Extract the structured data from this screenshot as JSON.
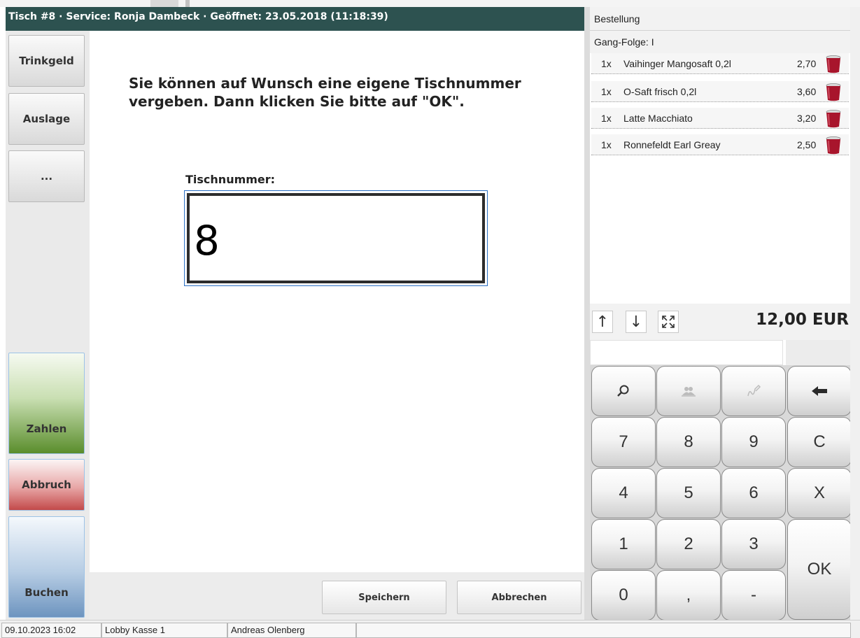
{
  "header": {
    "title": "Tisch #8 · Service: Ronja Dambeck · Geöffnet: 23.05.2018 (11:18:39)"
  },
  "sidebar": {
    "tip_label": "Trinkgeld",
    "display_label": "Auslage",
    "more_label": "...",
    "pay_label": "Zahlen",
    "abort_label": "Abbruch",
    "book_label": "Buchen"
  },
  "main": {
    "message": "Sie können auf Wunsch eine eigene Tischnummer vergeben. Dann klicken Sie bitte auf \"OK\".",
    "field_label": "Tischnummer:",
    "field_value": "8",
    "save_label": "Speichern",
    "cancel_label": "Abbrechen"
  },
  "order": {
    "title": "Bestellung",
    "course": "Gang-Folge: I",
    "items": [
      {
        "qty": "1x",
        "name": "Vaihinger Mangosaft 0,2l",
        "price": "2,70",
        "icon": "drink-cup-icon"
      },
      {
        "qty": "1x",
        "name": "O-Saft frisch 0,2l",
        "price": "3,60",
        "icon": "drink-cup-icon"
      },
      {
        "qty": "1x",
        "name": "Latte Macchiato",
        "price": "3,20",
        "icon": "drink-cup-icon"
      },
      {
        "qty": "1x",
        "name": "Ronnefeldt Earl Greay",
        "price": "2,50",
        "icon": "drink-cup-icon"
      }
    ],
    "tools": {
      "up": "↑",
      "down": "↓",
      "expand": "expand-icon"
    },
    "total": "12,00 EUR"
  },
  "keypad": {
    "search": "search-icon",
    "guests": "guests-icon",
    "sign": "signature-icon",
    "backspace": "backspace-arrow-icon",
    "k7": "7",
    "k8": "8",
    "k9": "9",
    "clear": "C",
    "k4": "4",
    "k5": "5",
    "k6": "6",
    "cancel": "X",
    "k1": "1",
    "k2": "2",
    "k3": "3",
    "ok": "OK",
    "k0": "0",
    "comma": ",",
    "minus": "-"
  },
  "status": {
    "datetime": "09.10.2023 16:02",
    "register": "Lobby Kasse 1",
    "user": "Andreas Olenberg"
  },
  "colors": {
    "header_bg": "#2d5250",
    "cup": "#a8152c",
    "pay_green": "#5a8d2c",
    "abort_red": "#c34a4a",
    "book_blue": "#6d94bf",
    "input_focus": "#2a6fc4"
  }
}
